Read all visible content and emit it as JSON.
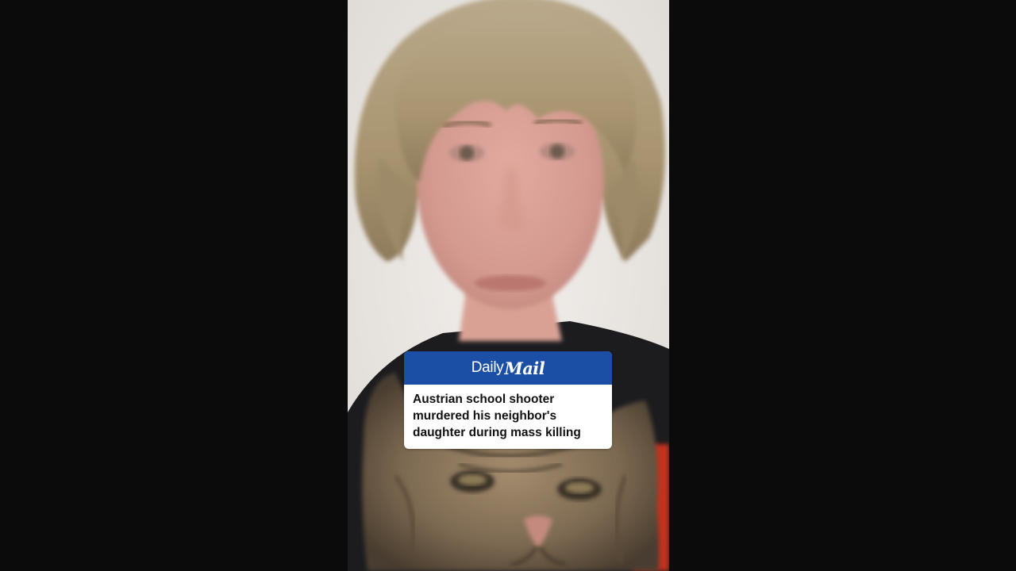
{
  "brand": {
    "daily": "Daily",
    "mail": "Mail",
    "bar_color": "#1b4fa6"
  },
  "headline": {
    "text": "Austrian school shooter murdered his neighbor's daughter during mass killing"
  },
  "photo": {
    "icon": "person-with-cat-photo"
  }
}
